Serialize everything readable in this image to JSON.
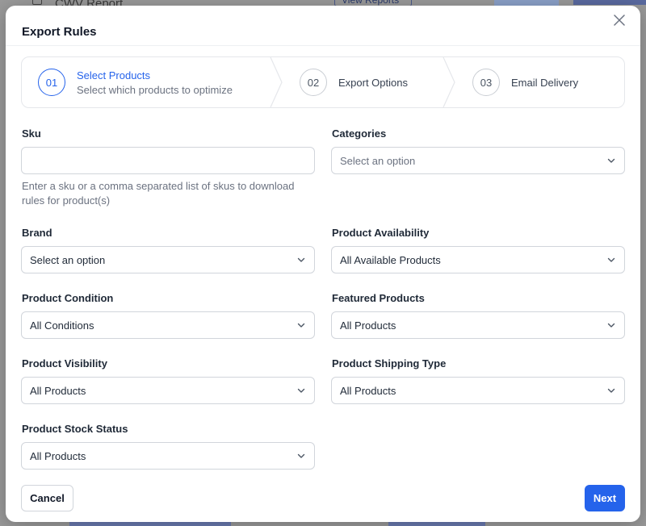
{
  "background": {
    "title": "CWV Report",
    "view_button": "View Reports"
  },
  "modal": {
    "title": "Export Rules",
    "close_icon": "close-icon"
  },
  "stepper": {
    "steps": [
      {
        "number": "01",
        "label": "Select Products",
        "subtitle": "Select which products to optimize",
        "active": true
      },
      {
        "number": "02",
        "label": "Export Options",
        "subtitle": "",
        "active": false
      },
      {
        "number": "03",
        "label": "Email Delivery",
        "subtitle": "",
        "active": false
      }
    ]
  },
  "form": {
    "sku": {
      "label": "Sku",
      "value": "",
      "placeholder": "",
      "help": "Enter a sku or a comma separated list of skus to download rules for product(s)"
    },
    "categories": {
      "label": "Categories",
      "value": "Select an option",
      "is_placeholder": true
    },
    "brand": {
      "label": "Brand",
      "value": "Select an option",
      "is_placeholder": false
    },
    "product_availability": {
      "label": "Product Availability",
      "value": "All Available Products"
    },
    "product_condition": {
      "label": "Product Condition",
      "value": "All Conditions"
    },
    "featured_products": {
      "label": "Featured Products",
      "value": "All Products"
    },
    "product_visibility": {
      "label": "Product Visibility",
      "value": "All Products"
    },
    "product_shipping_type": {
      "label": "Product Shipping Type",
      "value": "All Products"
    },
    "product_stock_status": {
      "label": "Product Stock Status",
      "value": "All Products"
    }
  },
  "footer": {
    "cancel_label": "Cancel",
    "next_label": "Next"
  },
  "colors": {
    "accent": "#2563eb",
    "border": "#d1d5db",
    "muted_text": "#6b7280"
  }
}
